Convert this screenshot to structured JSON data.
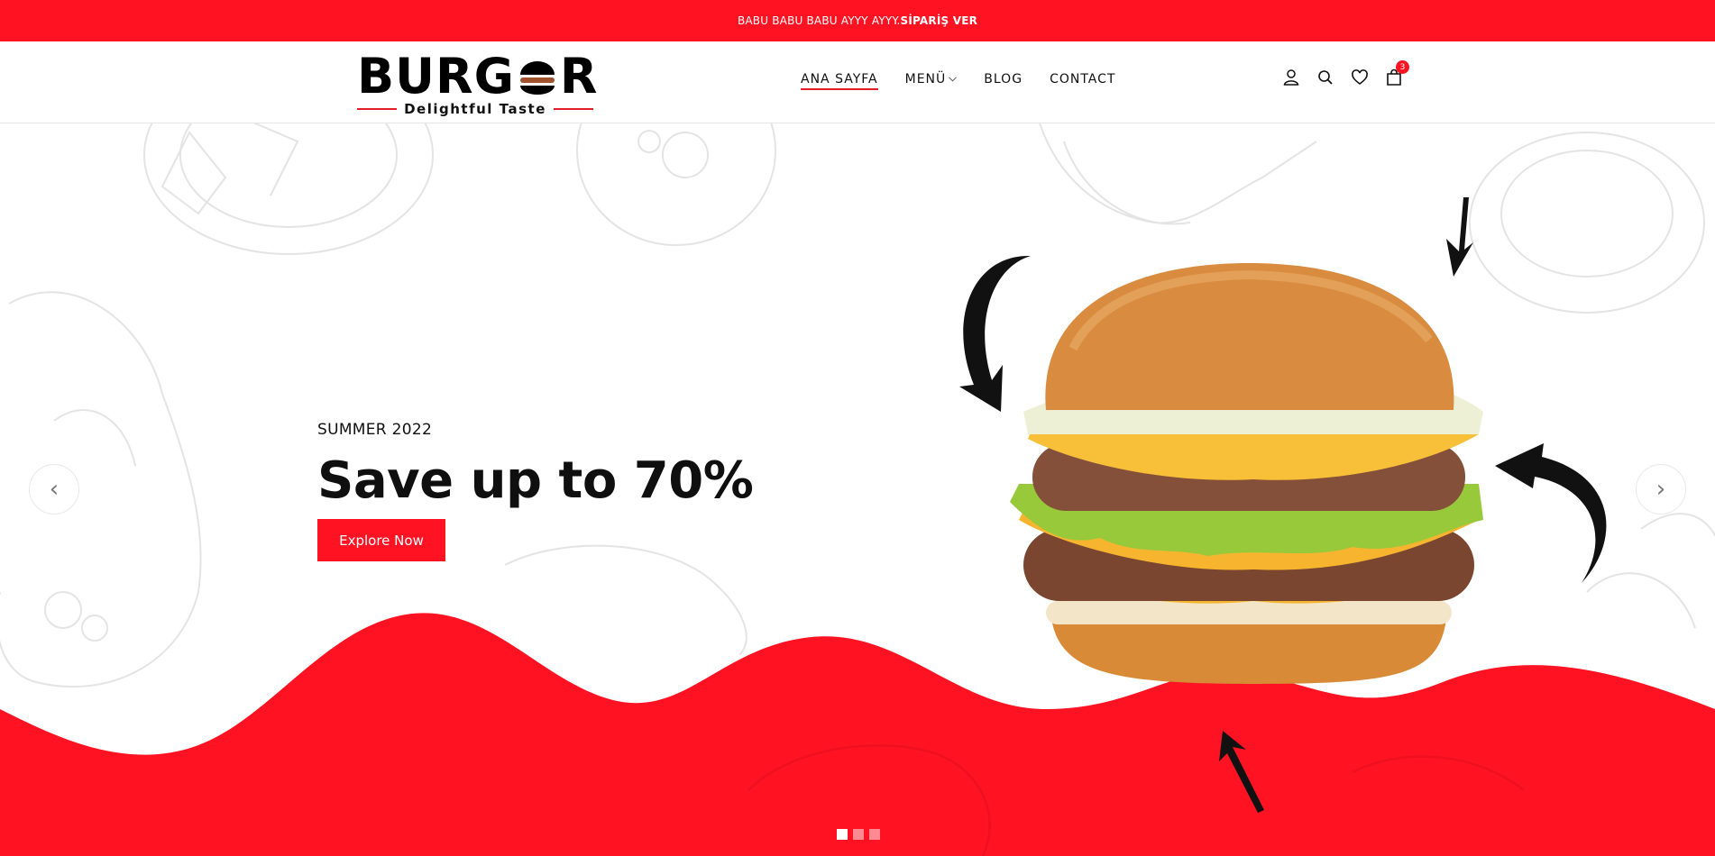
{
  "topbar": {
    "promo_text": "BABU BABU BABU AYYY AYYY.",
    "promo_link": "SİPARİŞ VER"
  },
  "brand": {
    "logo_prefix": "BURG",
    "logo_suffix": "R",
    "tagline": "Delightful Taste"
  },
  "nav": {
    "items": [
      {
        "label": "ANA SAYFA"
      },
      {
        "label": "MENÜ"
      },
      {
        "label": "BLOG"
      },
      {
        "label": "CONTACT"
      }
    ]
  },
  "header_icons": {
    "icons": [
      "user-icon",
      "search-icon",
      "heart-icon",
      "cart-icon"
    ],
    "cart_count": "3"
  },
  "hero": {
    "kicker": "SUMMER 2022",
    "title": "Save up to 70%",
    "button_label": "Explore Now",
    "prev_glyph": "‹",
    "next_glyph": "›",
    "slides": 3,
    "active_slide": 1
  },
  "colors": {
    "accent_red": "#ff1322",
    "text_dark": "#111111",
    "dot_inactive": "#ff8a91"
  }
}
